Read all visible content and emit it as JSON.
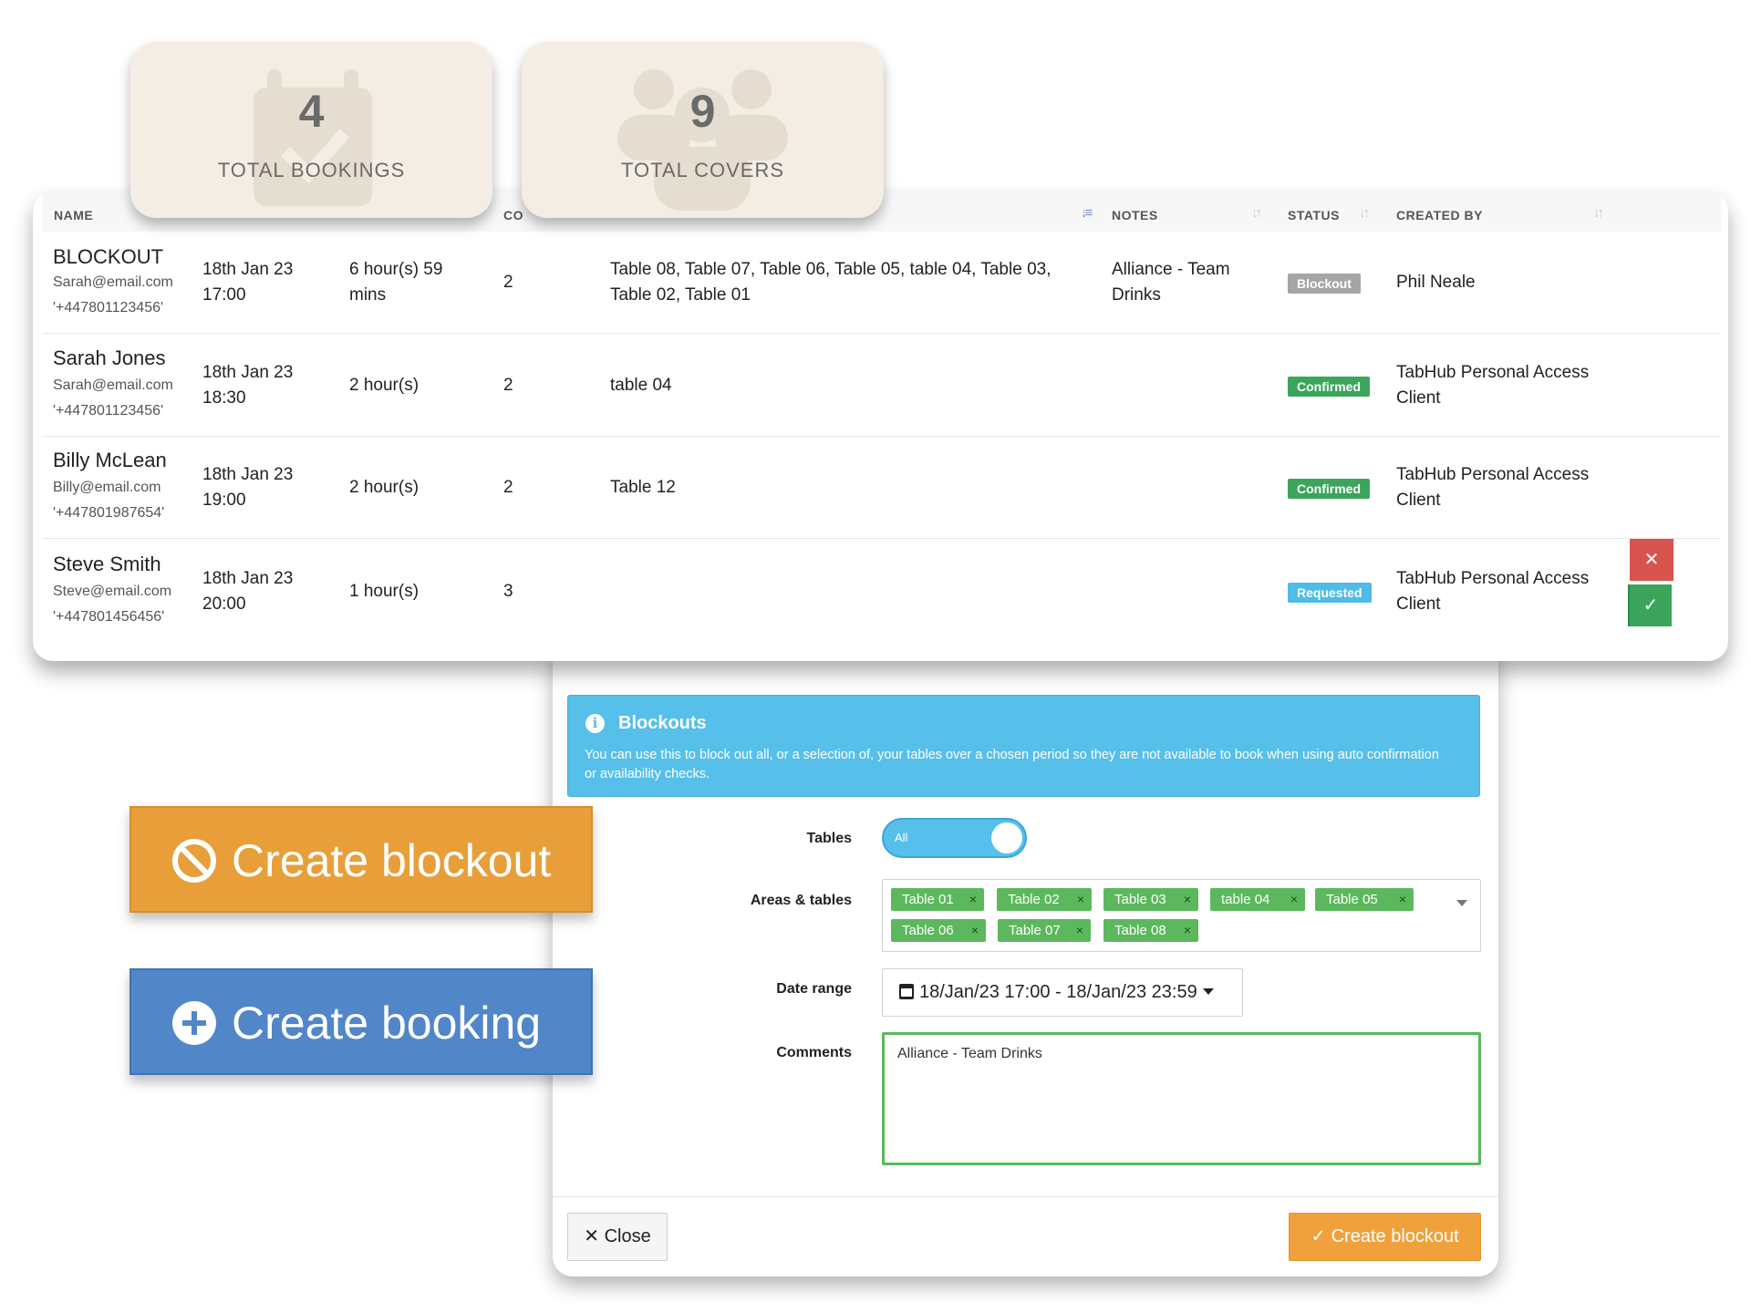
{
  "stats": [
    {
      "value": "4",
      "label": "TOTAL BOOKINGS",
      "icon": "calendar-check-icon"
    },
    {
      "value": "9",
      "label": "TOTAL COVERS",
      "icon": "users-icon"
    }
  ],
  "table": {
    "headers": {
      "name": "NAME",
      "covers": "CO",
      "notes": "NOTES",
      "status": "STATUS",
      "created_by": "CREATED BY"
    },
    "rows": [
      {
        "name": "BLOCKOUT",
        "email": "Sarah@email.com",
        "phone": "'+447801123456'",
        "date": "18th Jan 23",
        "time": "17:00",
        "duration1": "6 hour(s) 59",
        "duration2": "mins",
        "covers": "2",
        "tables1": "Table 08, Table 07, Table 06, Table 05, table 04, Table 03,",
        "tables2": "Table 02, Table 01",
        "notes1": "Alliance - Team",
        "notes2": "Drinks",
        "status": "Blockout",
        "created1": "Phil Neale",
        "created2": ""
      },
      {
        "name": "Sarah Jones",
        "email": "Sarah@email.com",
        "phone": "'+447801123456'",
        "date": "18th Jan 23",
        "time": "18:30",
        "duration1": "2 hour(s)",
        "duration2": "",
        "covers": "2",
        "tables1": "table 04",
        "tables2": "",
        "notes1": "",
        "notes2": "",
        "status": "Confirmed",
        "created1": "TabHub Personal Access",
        "created2": "Client"
      },
      {
        "name": "Billy McLean",
        "email": "Billy@email.com",
        "phone": "'+447801987654'",
        "date": "18th Jan 23",
        "time": "19:00",
        "duration1": "2 hour(s)",
        "duration2": "",
        "covers": "2",
        "tables1": "Table 12",
        "tables2": "",
        "notes1": "",
        "notes2": "",
        "status": "Confirmed",
        "created1": "TabHub Personal Access",
        "created2": "Client"
      },
      {
        "name": "Steve Smith",
        "email": "Steve@email.com",
        "phone": "'+447801456456'",
        "date": "18th Jan 23",
        "time": "20:00",
        "duration1": "1 hour(s)",
        "duration2": "",
        "covers": "3",
        "tables1": "",
        "tables2": "",
        "notes1": "",
        "notes2": "",
        "status": "Requested",
        "created1": "TabHub Personal Access",
        "created2": "Client"
      }
    ],
    "actions": {
      "reject": "✕",
      "accept": "✓"
    }
  },
  "modal": {
    "alert_title": "Blockouts",
    "alert_text": "You can use this to block out all, or a selection of, your tables over a chosen period so they are not available to book when using auto confirmation or availability checks.",
    "tables_label": "Tables",
    "toggle_text": "All",
    "areas_label": "Areas & tables",
    "tags": [
      "Table 01",
      "Table 02",
      "Table 03",
      "table 04",
      "Table 05",
      "Table 06",
      "Table 07",
      "Table 08"
    ],
    "tag_remove": "×",
    "date_label": "Date range",
    "date_value": "18/Jan/23 17:00 - 18/Jan/23 23:59",
    "comments_label": "Comments",
    "comments_value": "Alliance - Team Drinks",
    "close_label": "✕ Close",
    "submit_label": "✓ Create blockout"
  },
  "buttons": {
    "create_blockout": "Create blockout",
    "create_booking": "Create booking"
  },
  "colors": {
    "blockout_orange": "#e89f3a",
    "booking_blue": "#5186c8",
    "confirmed_green": "#3ba55c",
    "requested_blue": "#4fbbe8",
    "info_blue": "#56bfea"
  }
}
